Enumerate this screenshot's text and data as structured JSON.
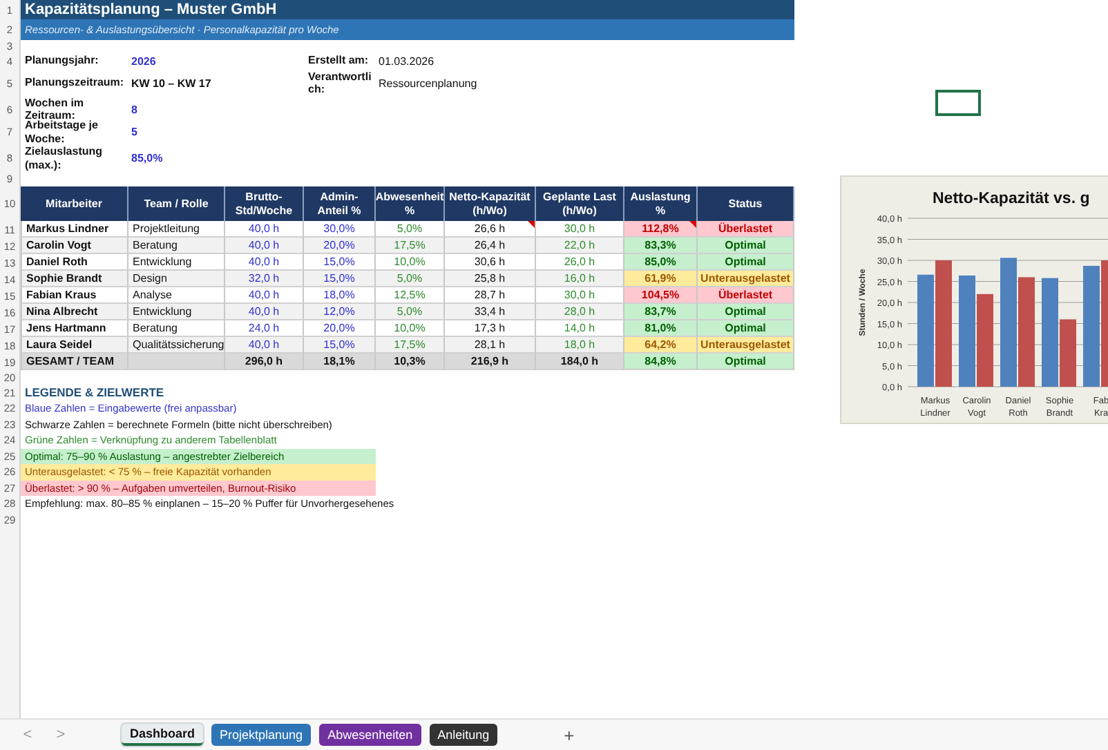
{
  "title": "Kapazitätsplanung – Muster GmbH",
  "subtitle": "Ressourcen- & Auslastungsübersicht  ·  Personalkapazität pro Woche",
  "row_numbers": [
    "1",
    "2",
    "3",
    "4",
    "5",
    "6",
    "7",
    "8",
    "9",
    "10",
    "11",
    "12",
    "13",
    "14",
    "15",
    "16",
    "17",
    "18",
    "19",
    "20",
    "21",
    "22",
    "23",
    "24",
    "25",
    "26",
    "27",
    "28",
    "29"
  ],
  "info": [
    {
      "label": "Planungsjahr:",
      "value": "2026",
      "kind": "input",
      "side_label": "Erstellt am:",
      "side_value": "01.03.2026"
    },
    {
      "label": "Planungszeitraum:",
      "value": "KW 10 – KW 17",
      "kind": "computed",
      "side_label": "Verantwortlich:",
      "side_value": "Ressourcenplanung"
    },
    {
      "label": "Wochen im Zeitraum:",
      "value": "8",
      "kind": "input"
    },
    {
      "label": "Arbeitstage je Woche:",
      "value": "5",
      "kind": "input"
    },
    {
      "label": "Zielauslastung (max.):",
      "value": "85,0%",
      "kind": "input"
    }
  ],
  "table": {
    "columns": [
      "Mitarbeiter",
      "Team / Rolle",
      "Brutto-Std/Woche",
      "Admin-Anteil %",
      "Abwesenheit %",
      "Netto-Kapazität (h/Wo)",
      "Geplante Last (h/Wo)",
      "Auslastung %",
      "Status"
    ],
    "rows": [
      {
        "name": "Markus Lindner",
        "role": "Projektleitung",
        "gross": "40,0 h",
        "admin": "30,0%",
        "absence": "5,0%",
        "net": "26,6 h",
        "planned": "30,0 h",
        "load": "112,8%",
        "status": "Überlastet",
        "color": "#ffc7ce",
        "net_comment": true,
        "load_comment": true
      },
      {
        "name": "Carolin Vogt",
        "role": "Beratung",
        "gross": "40,0 h",
        "admin": "20,0%",
        "absence": "17,5%",
        "net": "26,4 h",
        "planned": "22,0 h",
        "load": "83,3%",
        "status": "Optimal",
        "color": "#c6efce",
        "net_comment": false,
        "load_comment": false
      },
      {
        "name": "Daniel Roth",
        "role": "Entwicklung",
        "gross": "40,0 h",
        "admin": "15,0%",
        "absence": "10,0%",
        "net": "30,6 h",
        "planned": "26,0 h",
        "load": "85,0%",
        "status": "Optimal",
        "color": "#c6efce",
        "net_comment": false,
        "load_comment": false
      },
      {
        "name": "Sophie Brandt",
        "role": "Design",
        "gross": "32,0 h",
        "admin": "15,0%",
        "absence": "5,0%",
        "net": "25,8 h",
        "planned": "16,0 h",
        "load": "61,9%",
        "status": "Unterausgelastet",
        "color": "#ffeb9c",
        "net_comment": false,
        "load_comment": false
      },
      {
        "name": "Fabian Kraus",
        "role": "Analyse",
        "gross": "40,0 h",
        "admin": "18,0%",
        "absence": "12,5%",
        "net": "28,7 h",
        "planned": "30,0 h",
        "load": "104,5%",
        "status": "Überlastet",
        "color": "#ffc7ce",
        "net_comment": false,
        "load_comment": false
      },
      {
        "name": "Nina Albrecht",
        "role": "Entwicklung",
        "gross": "40,0 h",
        "admin": "12,0%",
        "absence": "5,0%",
        "net": "33,4 h",
        "planned": "28,0 h",
        "load": "83,7%",
        "status": "Optimal",
        "color": "#c6efce",
        "net_comment": false,
        "load_comment": false
      },
      {
        "name": "Jens Hartmann",
        "role": "Beratung",
        "gross": "24,0 h",
        "admin": "20,0%",
        "absence": "10,0%",
        "net": "17,3 h",
        "planned": "14,0 h",
        "load": "81,0%",
        "status": "Optimal",
        "color": "#c6efce",
        "net_comment": false,
        "load_comment": false
      },
      {
        "name": "Laura Seidel",
        "role": "Qualitätssicherung",
        "gross": "40,0 h",
        "admin": "15,0%",
        "absence": "17,5%",
        "net": "28,1 h",
        "planned": "18,0 h",
        "load": "64,2%",
        "status": "Unterausgelastet",
        "color": "#ffeb9c",
        "net_comment": false,
        "load_comment": false
      }
    ],
    "total": {
      "name": "GESAMT / TEAM",
      "gross": "296,0 h",
      "admin": "18,1%",
      "absence": "10,3%",
      "net": "216,9 h",
      "planned": "184,0 h",
      "load": "84,8%",
      "status": "Optimal",
      "color": "#c6efce"
    }
  },
  "legend": {
    "heading": "LEGENDE & ZIELWERTE",
    "items": [
      {
        "text": "Blaue Zahlen = Eingabewerte (frei anpassbar)",
        "kind": "input"
      },
      {
        "text": "Schwarze Zahlen = berechnete Formeln (bitte nicht überschreiben)",
        "kind": "formula"
      },
      {
        "text": "Grüne Zahlen = Verknüpfung zu anderem Tabellenblatt",
        "kind": "link"
      },
      {
        "text": "Optimal: 75–90 % Auslastung – angestrebter Zielbereich",
        "kind": "optimal"
      },
      {
        "text": "Unterausgelastet: < 75 % – freie Kapazität vorhanden",
        "kind": "under"
      },
      {
        "text": "Überlastet: > 90 % – Aufgaben umverteilen, Burnout-Risiko",
        "kind": "over"
      },
      {
        "text": "Empfehlung: max. 80–85 % einplanen – 15–20 % Puffer für Unvorhergesehenes",
        "kind": "formula"
      }
    ]
  },
  "chart_data": {
    "type": "bar",
    "title": "Netto-Kapazität vs. g",
    "ylabel": "Stunden / Woche",
    "categories": [
      "Markus Lindner",
      "Carolin Vogt",
      "Daniel Roth",
      "Sophie Brandt",
      "Fab Kra"
    ],
    "series": [
      {
        "color": "#4f81bd",
        "values": [
          26.6,
          26.4,
          30.6,
          25.8,
          28.7
        ]
      },
      {
        "color": "#c0504d",
        "values": [
          30,
          22,
          26,
          16,
          30
        ]
      }
    ],
    "ylim": [
      0,
      40
    ],
    "grid": true,
    "yticks": [
      {
        "value": 0,
        "label": "0,0 h"
      },
      {
        "value": 5,
        "label": "5,0 h"
      },
      {
        "value": 10,
        "label": "10,0 h"
      },
      {
        "value": 15,
        "label": "15,0 h"
      },
      {
        "value": 20,
        "label": "20,0 h"
      },
      {
        "value": 25,
        "label": "25,0 h"
      },
      {
        "value": 30,
        "label": "30,0 h"
      },
      {
        "value": 35,
        "label": "35,0 h"
      },
      {
        "value": 40,
        "label": "40,0 h"
      }
    ]
  },
  "sheet_tabs": [
    {
      "label": "Dashboard",
      "color": "#e8eef0",
      "selected": true
    },
    {
      "label": "Projektplanung",
      "color": "#2e75b6",
      "selected": false
    },
    {
      "label": "Abwesenheiten",
      "color": "#7030a0",
      "selected": false
    },
    {
      "label": "Anleitung",
      "color": "#333333",
      "selected": false
    }
  ],
  "nav": {
    "prev": "<",
    "next": ">",
    "add": "+"
  }
}
